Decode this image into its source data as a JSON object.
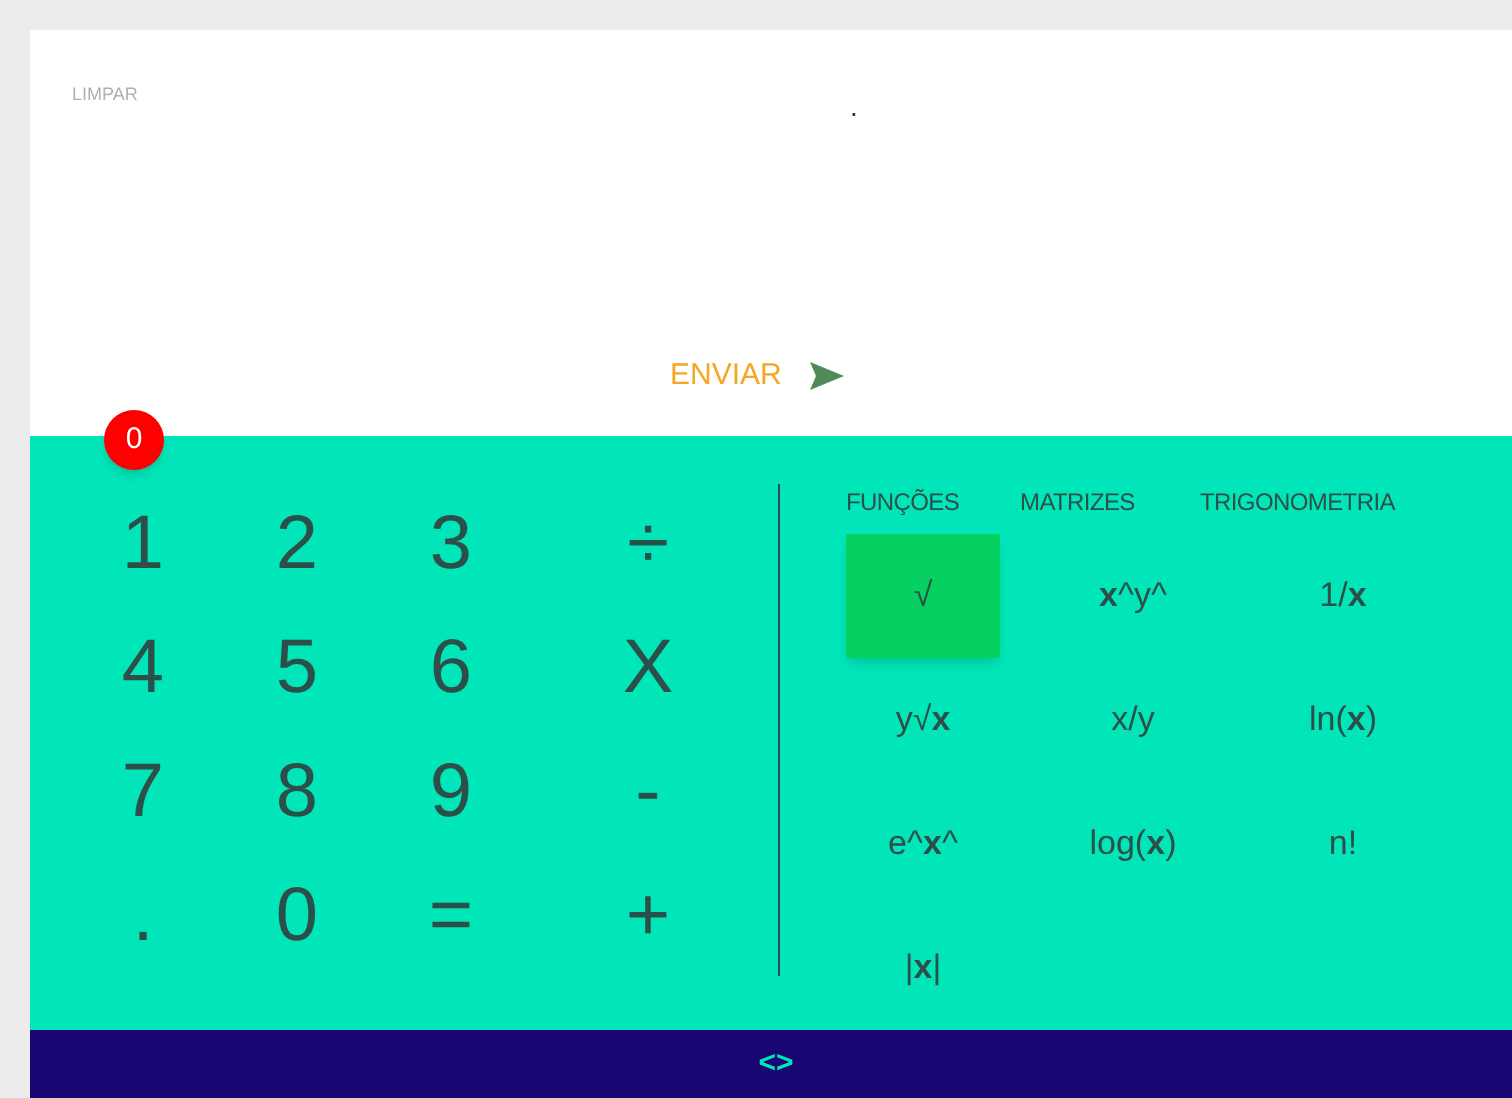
{
  "clear_button": "LIMPAR",
  "display": ".",
  "send_button": "ENVIAR",
  "badge": "0",
  "keypad": [
    "1",
    "2",
    "3",
    "÷",
    "4",
    "5",
    "6",
    "X",
    "7",
    "8",
    "9",
    "-",
    ".",
    "0",
    "=",
    "+"
  ],
  "tabs": [
    {
      "label": "FUNÇÕES"
    },
    {
      "label": "MATRIZES"
    },
    {
      "label": "TRIGONOMETRIA"
    }
  ],
  "functions": [
    {
      "label": "√",
      "selected": true
    },
    {
      "label": "**x**^y^",
      "selected": false
    },
    {
      "label": "1/**x**",
      "selected": false
    },
    {
      "label": "y√**x**",
      "selected": false
    },
    {
      "label": "x/y",
      "selected": false
    },
    {
      "label": "ln(**x**)",
      "selected": false
    },
    {
      "label": "e^**x**^",
      "selected": false
    },
    {
      "label": "log(**x**)",
      "selected": false
    },
    {
      "label": "n!",
      "selected": false
    },
    {
      "label": "|**x**|",
      "selected": false
    }
  ],
  "footer_toggle": "<>"
}
